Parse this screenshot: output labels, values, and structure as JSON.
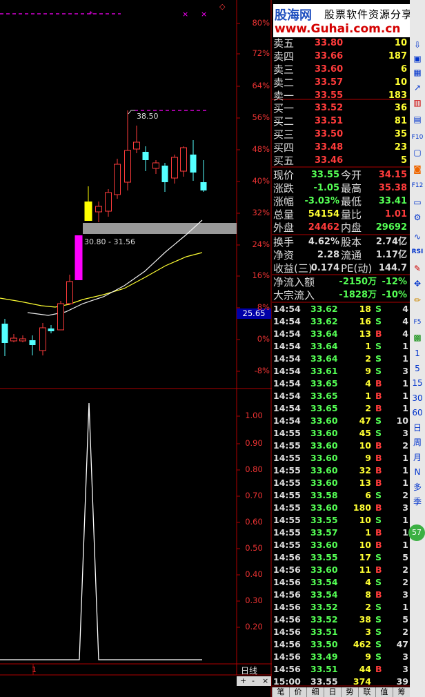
{
  "logo": {
    "brand": "股海网",
    "slogan": "股票软件资源分享",
    "url": "www.Guhai.com.cn"
  },
  "chart": {
    "y_axis_labels": [
      "80%",
      "72%",
      "64%",
      "56%",
      "48%",
      "40%",
      "32%",
      "24%",
      "16%",
      "8%",
      "0%",
      "-8%"
    ],
    "price_tag": "25.65",
    "peak_label": "38.50",
    "range_label": "30.80 - 31.56",
    "volume_axis_labels": [
      "1.00",
      "0.90",
      "0.80",
      "0.70",
      "0.60",
      "0.50",
      "0.40",
      "0.30",
      "0.20"
    ],
    "x_tick_label": "1",
    "period_label": "日线",
    "zoom_buttons": [
      "+",
      "-",
      "×"
    ],
    "colors": {
      "up": "#ff3b3b",
      "down": "#54ffff",
      "yellow": "#ffff00",
      "magenta": "#ff00ff",
      "grid_red": "#b00000"
    }
  },
  "orderbook": {
    "asks": [
      {
        "label": "卖五",
        "price": "33.80",
        "vol": "10"
      },
      {
        "label": "卖四",
        "price": "33.66",
        "vol": "187"
      },
      {
        "label": "卖三",
        "price": "33.60",
        "vol": "6"
      },
      {
        "label": "卖二",
        "price": "33.57",
        "vol": "10"
      },
      {
        "label": "卖一",
        "price": "33.55",
        "vol": "183"
      }
    ],
    "bids": [
      {
        "label": "买一",
        "price": "33.52",
        "vol": "36"
      },
      {
        "label": "买二",
        "price": "33.51",
        "vol": "81"
      },
      {
        "label": "买三",
        "price": "33.50",
        "vol": "35"
      },
      {
        "label": "买四",
        "price": "33.48",
        "vol": "23"
      },
      {
        "label": "买五",
        "price": "33.46",
        "vol": "5"
      }
    ]
  },
  "quote": [
    {
      "l1": "现价",
      "v1": "33.55",
      "l2": "今开",
      "v2": "34.15"
    },
    {
      "l1": "涨跌",
      "v1": "-1.05",
      "l2": "最高",
      "v2": "35.38"
    },
    {
      "l1": "涨幅",
      "v1": "-3.03%",
      "l2": "最低",
      "v2": "33.41"
    },
    {
      "l1": "总量",
      "v1": "54154",
      "l2": "量比",
      "v2": "1.01"
    },
    {
      "l1": "外盘",
      "v1": "24462",
      "l2": "内盘",
      "v2": "29692"
    }
  ],
  "fundamentals": [
    {
      "l1": "换手",
      "v1": "4.62%",
      "l2": "股本",
      "v2": "2.74亿"
    },
    {
      "l1": "净资",
      "v1": "2.28",
      "l2": "流通",
      "v2": "1.17亿"
    },
    {
      "l1": "收益(三)",
      "v1": "0.174",
      "l2": "PE(动)",
      "v2": "144.7"
    }
  ],
  "flows": [
    {
      "label": "净流入额",
      "value": "-2150万",
      "pct": "-12%"
    },
    {
      "label": "大宗流入",
      "value": "-1828万",
      "pct": "-10%"
    }
  ],
  "ticks": [
    {
      "t": "14:54",
      "p": "33.62",
      "v": "18",
      "s": "S",
      "n": "4"
    },
    {
      "t": "14:54",
      "p": "33.62",
      "v": "16",
      "s": "S",
      "n": "4"
    },
    {
      "t": "14:54",
      "p": "33.64",
      "v": "13",
      "s": "B",
      "n": "4"
    },
    {
      "t": "14:54",
      "p": "33.64",
      "v": "1",
      "s": "S",
      "n": "1"
    },
    {
      "t": "14:54",
      "p": "33.64",
      "v": "2",
      "s": "S",
      "n": "1"
    },
    {
      "t": "14:54",
      "p": "33.61",
      "v": "9",
      "s": "S",
      "n": "3"
    },
    {
      "t": "14:54",
      "p": "33.65",
      "v": "4",
      "s": "B",
      "n": "1"
    },
    {
      "t": "14:54",
      "p": "33.65",
      "v": "1",
      "s": "B",
      "n": "1"
    },
    {
      "t": "14:54",
      "p": "33.65",
      "v": "2",
      "s": "B",
      "n": "1"
    },
    {
      "t": "14:54",
      "p": "33.60",
      "v": "47",
      "s": "S",
      "n": "10"
    },
    {
      "t": "14:55",
      "p": "33.60",
      "v": "45",
      "s": "S",
      "n": "3"
    },
    {
      "t": "14:55",
      "p": "33.60",
      "v": "10",
      "s": "B",
      "n": "2"
    },
    {
      "t": "14:55",
      "p": "33.60",
      "v": "9",
      "s": "B",
      "n": "1"
    },
    {
      "t": "14:55",
      "p": "33.60",
      "v": "32",
      "s": "B",
      "n": "1"
    },
    {
      "t": "14:55",
      "p": "33.60",
      "v": "13",
      "s": "B",
      "n": "1"
    },
    {
      "t": "14:55",
      "p": "33.58",
      "v": "6",
      "s": "S",
      "n": "2"
    },
    {
      "t": "14:55",
      "p": "33.60",
      "v": "180",
      "s": "B",
      "n": "3"
    },
    {
      "t": "14:55",
      "p": "33.55",
      "v": "10",
      "s": "S",
      "n": "1"
    },
    {
      "t": "14:55",
      "p": "33.57",
      "v": "1",
      "s": "B",
      "n": "1"
    },
    {
      "t": "14:55",
      "p": "33.60",
      "v": "10",
      "s": "B",
      "n": "1"
    },
    {
      "t": "14:56",
      "p": "33.55",
      "v": "17",
      "s": "S",
      "n": "5"
    },
    {
      "t": "14:56",
      "p": "33.60",
      "v": "11",
      "s": "B",
      "n": "2"
    },
    {
      "t": "14:56",
      "p": "33.54",
      "v": "4",
      "s": "S",
      "n": "2"
    },
    {
      "t": "14:56",
      "p": "33.54",
      "v": "8",
      "s": "B",
      "n": "3"
    },
    {
      "t": "14:56",
      "p": "33.52",
      "v": "2",
      "s": "S",
      "n": "1"
    },
    {
      "t": "14:56",
      "p": "33.52",
      "v": "38",
      "s": "S",
      "n": "5"
    },
    {
      "t": "14:56",
      "p": "33.51",
      "v": "3",
      "s": "S",
      "n": "2"
    },
    {
      "t": "14:56",
      "p": "33.50",
      "v": "462",
      "s": "S",
      "n": "47"
    },
    {
      "t": "14:56",
      "p": "33.49",
      "v": "9",
      "s": "S",
      "n": "3"
    },
    {
      "t": "14:56",
      "p": "33.51",
      "v": "44",
      "s": "B",
      "n": "3"
    },
    {
      "t": "15:00",
      "p": "33.55",
      "v": "374",
      "s": "",
      "n": "39"
    }
  ],
  "bottom_tabs": [
    "笔",
    "价",
    "细",
    "日",
    "势",
    "联",
    "值",
    "筹"
  ],
  "toolbar": {
    "periods": [
      "1",
      "5",
      "15",
      "30",
      "60",
      "日",
      "周",
      "月",
      "N",
      "多",
      "季"
    ],
    "rsi_label": "RSI",
    "f10_label": "F10",
    "f5_label": "F5",
    "f12_label": "F12",
    "badge": "57"
  }
}
